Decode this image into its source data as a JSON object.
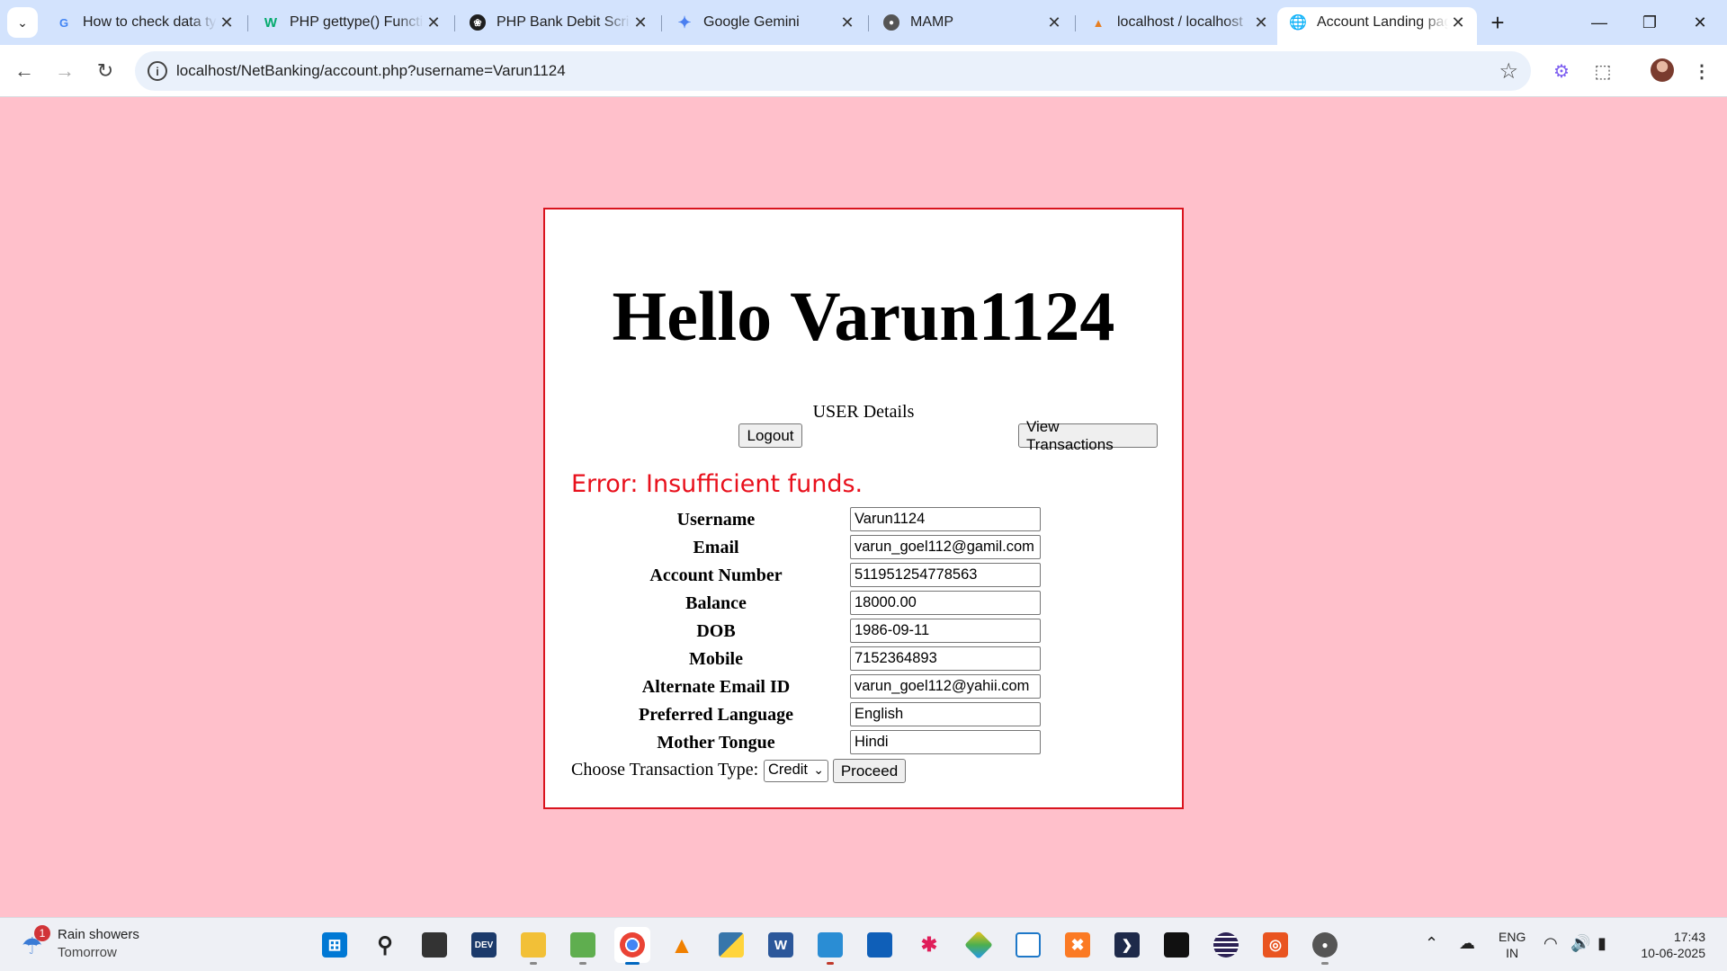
{
  "browser": {
    "tabs": [
      {
        "title": "How to check data ty",
        "icon": "google-icon",
        "active": false
      },
      {
        "title": "PHP gettype() Functi",
        "icon": "w3-icon",
        "active": false
      },
      {
        "title": "PHP Bank Debit Scrip",
        "icon": "openai-icon",
        "active": false
      },
      {
        "title": "Google Gemini",
        "icon": "gemini-icon",
        "active": false
      },
      {
        "title": "MAMP",
        "icon": "mamp-icon",
        "active": false
      },
      {
        "title": "localhost / localhost",
        "icon": "phpmyadmin-icon",
        "active": false
      },
      {
        "title": "Account Landing pag",
        "icon": "globe-icon",
        "active": true
      }
    ],
    "url": "localhost/NetBanking/account.php?username=Varun1124"
  },
  "page": {
    "greeting_word": "Hello",
    "greeting_user": "Varun1124",
    "details_label": "USER Details",
    "logout_label": "Logout",
    "view_transactions_label": "View Transactions",
    "error_message": "Error: Insufficient funds.",
    "fields": [
      {
        "label": "Username",
        "value": "Varun1124"
      },
      {
        "label": "Email",
        "value": "varun_goel112@gamil.com"
      },
      {
        "label": "Account Number",
        "value": "511951254778563"
      },
      {
        "label": "Balance",
        "value": "18000.00"
      },
      {
        "label": "DOB",
        "value": "1986-09-11"
      },
      {
        "label": "Mobile",
        "value": "7152364893"
      },
      {
        "label": "Alternate Email ID",
        "value": "varun_goel112@yahii.com"
      },
      {
        "label": "Preferred Language",
        "value": "English"
      },
      {
        "label": "Mother Tongue",
        "value": "Hindi"
      }
    ],
    "transaction_label": "Choose Transaction Type:",
    "transaction_selected": "Credit",
    "proceed_label": "Proceed"
  },
  "taskbar": {
    "weather_badge": "1",
    "weather_title": "Rain showers",
    "weather_sub": "Tomorrow",
    "lang_top": "ENG",
    "lang_bottom": "IN",
    "time": "17:43",
    "date": "10-06-2025"
  },
  "colors": {
    "page_background": "#ffc0cb",
    "card_border": "#d9141e",
    "error_text": "#e8101c"
  }
}
